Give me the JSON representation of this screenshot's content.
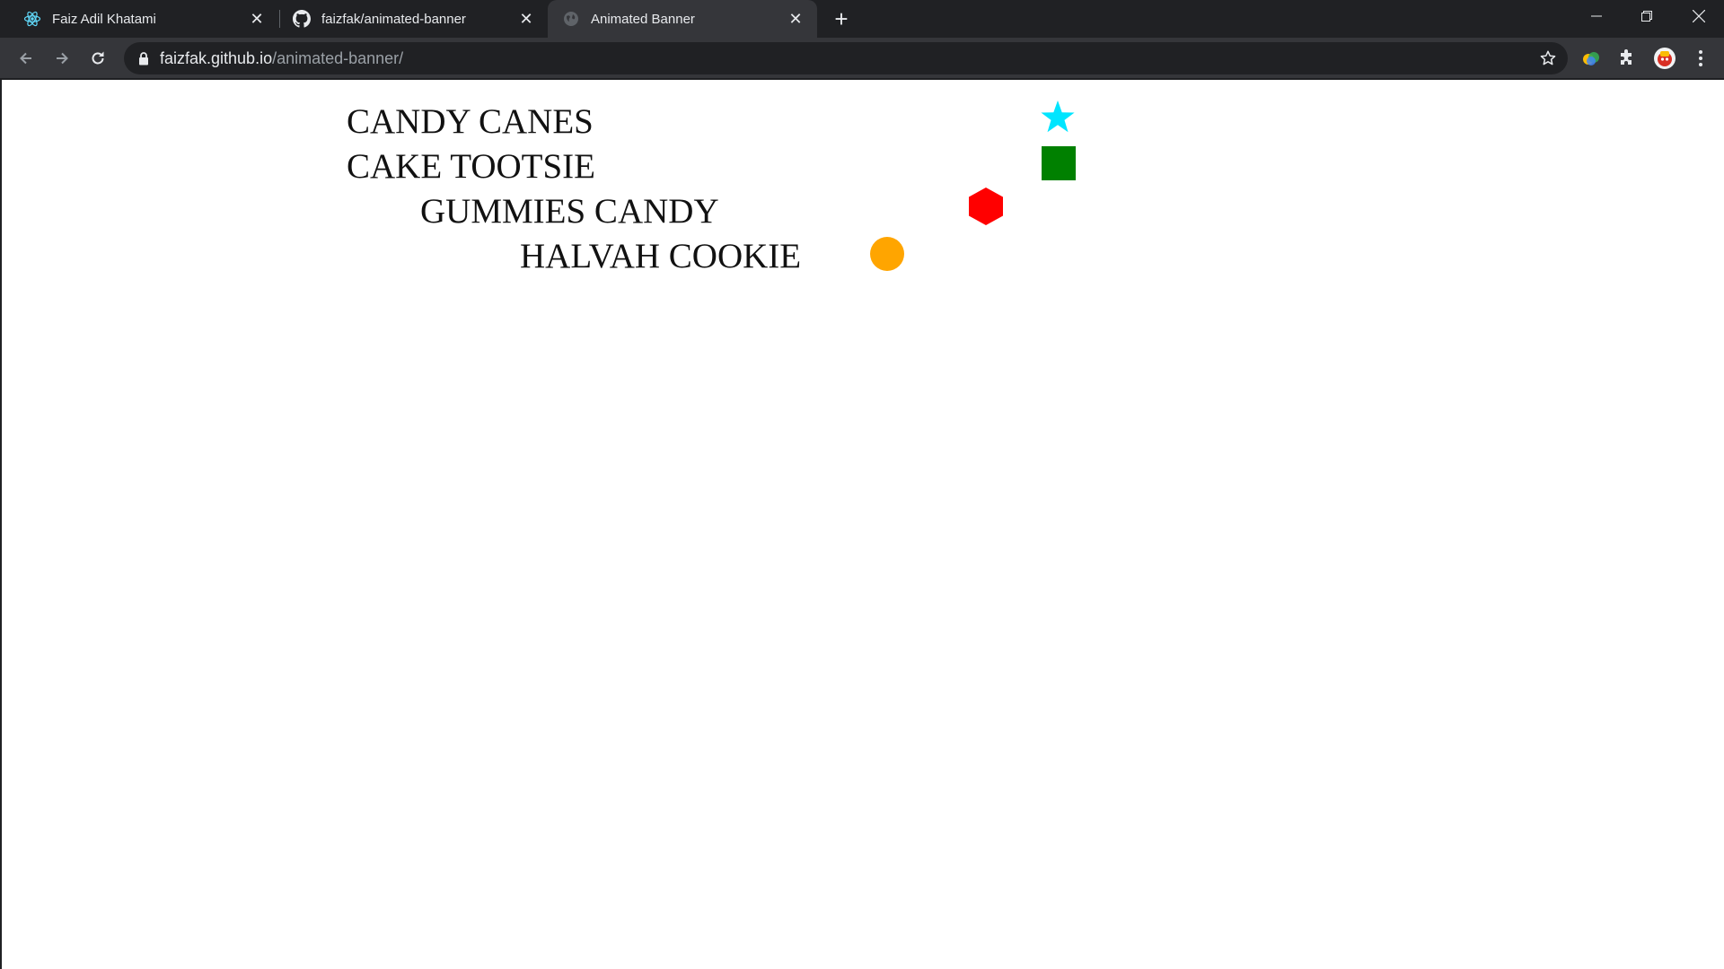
{
  "browser": {
    "tabs": [
      {
        "title": "Faiz Adil Khatami",
        "icon": "react-atom-icon",
        "active": false
      },
      {
        "title": "faizfak/animated-banner",
        "icon": "github-icon",
        "active": false
      },
      {
        "title": "Animated Banner",
        "icon": "globe-icon",
        "active": true
      }
    ],
    "new_tab_label": "+",
    "close_glyph": "✕",
    "address": {
      "host": "faizfak.github.io",
      "path": "/animated-banner/"
    }
  },
  "page": {
    "lines": [
      {
        "text": "CANDY CANES",
        "shape": "star",
        "color": "#00e5ff"
      },
      {
        "text": "CAKE TOOTSIE",
        "shape": "square",
        "color": "#008000"
      },
      {
        "text": "GUMMIES CANDY",
        "shape": "hexagon",
        "color": "#ff0000"
      },
      {
        "text": "HALVAH COOKIE",
        "shape": "circle",
        "color": "#ffa500"
      }
    ]
  },
  "colors": {
    "chrome_dark": "#202124",
    "chrome_toolbar": "#35363a",
    "page_background": "#ffffff"
  }
}
